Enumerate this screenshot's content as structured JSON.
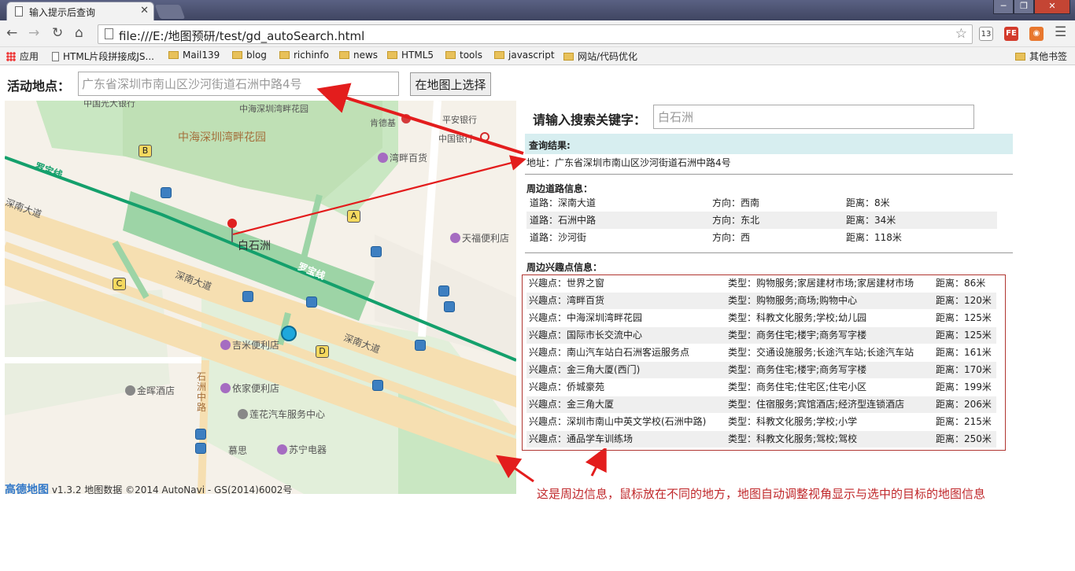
{
  "browser": {
    "tab_title": "输入提示后查询",
    "tab_close": "✕",
    "url": "file:///E:/地图预研/test/gd_autoSearch.html",
    "window_buttons": {
      "min": "─",
      "max": "❐",
      "close": "✕"
    },
    "bookmarks": [
      {
        "label": "应用",
        "icon": "apps-icon"
      },
      {
        "label": "HTML片段拼接成JS...",
        "icon": "page-icon"
      },
      {
        "label": "Mail139",
        "icon": "folder-icon"
      },
      {
        "label": "blog",
        "icon": "folder-icon"
      },
      {
        "label": "richinfo",
        "icon": "folder-icon"
      },
      {
        "label": "news",
        "icon": "folder-icon"
      },
      {
        "label": "HTML5",
        "icon": "folder-icon"
      },
      {
        "label": "tools",
        "icon": "folder-icon"
      },
      {
        "label": "javascript",
        "icon": "folder-icon"
      },
      {
        "label": "网站/代码优化",
        "icon": "folder-icon"
      }
    ],
    "other_bookmarks": "其他书签",
    "ext_icons": {
      "counter": "13",
      "fe": "FE"
    }
  },
  "page": {
    "place_label": "活动地点：",
    "place_value": "广东省深圳市南山区沙河街道石洲中路4号",
    "choose_button": "在地图上选择",
    "keyword_label": "请输入搜索关键字：",
    "keyword_value": "白石洲",
    "result_header": "查询结果:",
    "result_address": "地址：广东省深圳市南山区沙河街道石洲中路4号",
    "road_title": "周边道路信息：",
    "roads": [
      {
        "road": "道路：深南大道",
        "dir": "方向：西南",
        "dist": "距离：8米"
      },
      {
        "road": "道路：石洲中路",
        "dir": "方向：东北",
        "dist": "距离：34米"
      },
      {
        "road": "道路：沙河街",
        "dir": "方向：西",
        "dist": "距离：118米"
      }
    ],
    "poi_title": "周边兴趣点信息：",
    "pois": [
      {
        "name": "兴趣点：世界之窗",
        "type": "类型：购物服务;家居建材市场;家居建材市场",
        "dist": "距离：86米"
      },
      {
        "name": "兴趣点：湾畔百货",
        "type": "类型：购物服务;商场;购物中心",
        "dist": "距离：120米"
      },
      {
        "name": "兴趣点：中海深圳湾畔花园",
        "type": "类型：科教文化服务;学校;幼儿园",
        "dist": "距离：125米"
      },
      {
        "name": "兴趣点：国际市长交流中心",
        "type": "类型：商务住宅;楼宇;商务写字楼",
        "dist": "距离：125米"
      },
      {
        "name": "兴趣点：南山汽车站白石洲客运服务点",
        "type": "类型：交通设施服务;长途汽车站;长途汽车站",
        "dist": "距离：161米"
      },
      {
        "name": "兴趣点：金三角大厦(西门)",
        "type": "类型：商务住宅;楼宇;商务写字楼",
        "dist": "距离：170米"
      },
      {
        "name": "兴趣点：侨城豪苑",
        "type": "类型：商务住宅;住宅区;住宅小区",
        "dist": "距离：199米"
      },
      {
        "name": "兴趣点：金三角大厦",
        "type": "类型：住宿服务;宾馆酒店;经济型连锁酒店",
        "dist": "距离：206米"
      },
      {
        "name": "兴趣点：深圳市南山中英文学校(石洲中路)",
        "type": "类型：科教文化服务;学校;小学",
        "dist": "距离：215米"
      },
      {
        "name": "兴趣点：通品学车训练场",
        "type": "类型：科教文化服务;驾校;驾校",
        "dist": "距离：250米"
      }
    ],
    "annotation": "这是周边信息，鼠标放在不同的地方，地图自动调整视角显示与选中的目标的地图信息"
  },
  "map": {
    "labels": {
      "garden": "中海深圳湾畔花园",
      "garden_small": "中海深圳湾畔花园",
      "bank": "中国光大银行",
      "kfc": "肯德基",
      "pingan": "平安银行",
      "icbc": "中国银行",
      "wanpan": "湾畔百货",
      "line1": "罗宝线",
      "line2": "罗宝线",
      "road1": "深南大道",
      "road2": "深南大道",
      "road3": "深南大道",
      "station": "白石洲",
      "tianfu": "天福便利店",
      "jimi": "吉米便利店",
      "yijia": "依家便利店",
      "jinhui": "金晖酒店",
      "lianhua": "莲花汽车服务中心",
      "mushi": "慕思",
      "suning": "苏宁电器",
      "shizhou": "石洲中路"
    },
    "exits": [
      "A",
      "B",
      "C",
      "D"
    ],
    "credit_logo": "高德地图",
    "credit_text": "v1.3.2 地图数据 ©2014 AutoNavi - GS(2014)6002号",
    "colors": {
      "metro": "#14a06c",
      "road": "#f6dfb1",
      "green": "#c9e7c2",
      "annotation": "#c0282b"
    }
  }
}
